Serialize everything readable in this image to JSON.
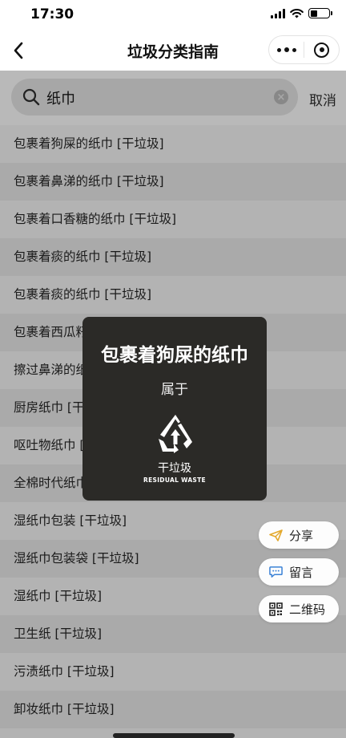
{
  "status_bar": {
    "time": "17:30",
    "battery_level": 0.4
  },
  "nav": {
    "title": "垃圾分类指南"
  },
  "search": {
    "query": "纸巾",
    "cancel_label": "取消"
  },
  "results": [
    "包裹着狗屎的纸巾 [干垃圾]",
    "包裹着鼻涕的纸巾 [干垃圾]",
    "包裹着口香糖的纸巾 [干垃圾]",
    "包裹着痰的纸巾 [干垃圾]",
    "包裹着痰的纸巾 [干垃圾]",
    "包裹着西瓜籽的纸巾 [干垃圾]",
    "擦过鼻涕的纸巾 [干垃圾]",
    "厨房纸巾 [干垃圾]",
    "呕吐物纸巾 [干垃圾]",
    "全棉时代纸巾 [干垃圾]",
    "湿纸巾包装 [干垃圾]",
    "湿纸巾包装袋 [干垃圾]",
    "湿纸巾 [干垃圾]",
    "卫生纸 [干垃圾]",
    "污渍纸巾 [干垃圾]",
    "卸妆纸巾 [干垃圾]"
  ],
  "popup": {
    "item_name": "包裹着狗屎的纸巾",
    "belongs_label": "属于",
    "category_name": "干垃圾",
    "category_en": "RESIDUAL WASTE",
    "logo_icon": "residual-waste-recycle-icon"
  },
  "actions": {
    "share_label": "分享",
    "comment_label": "留言",
    "qrcode_label": "二维码"
  },
  "colors": {
    "overlay_gray": "#b3b3b3",
    "popup_bg": "#2b2a27",
    "share_icon": "#e3a82b",
    "comment_icon": "#3b82d6"
  }
}
